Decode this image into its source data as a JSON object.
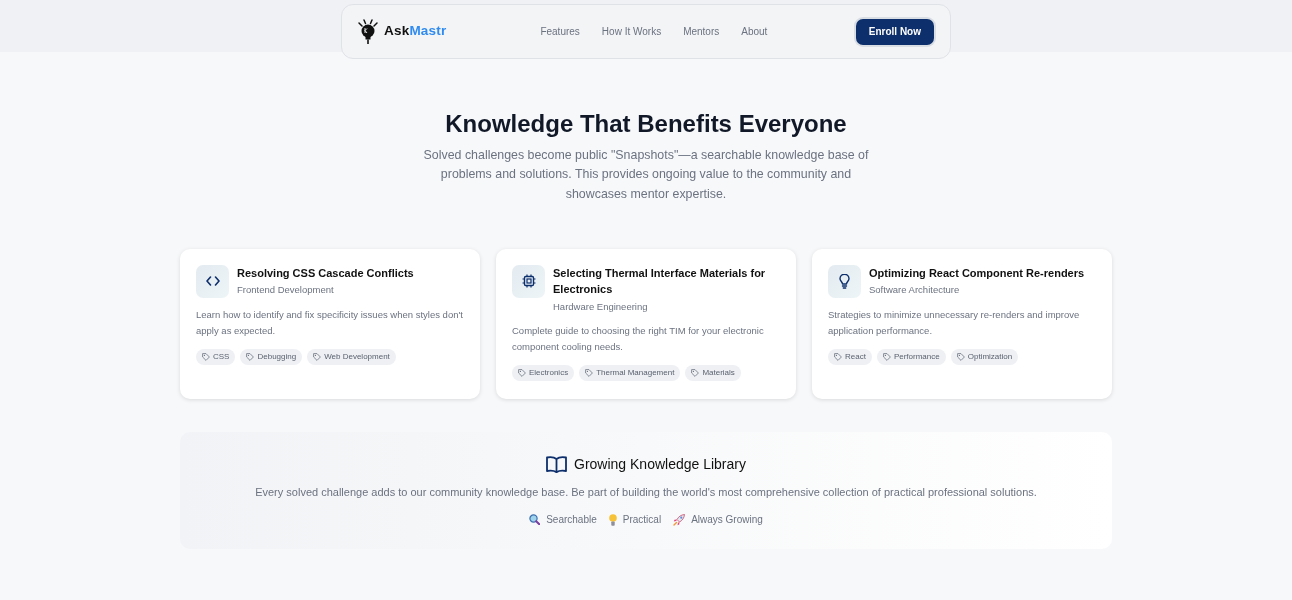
{
  "nav": {
    "brand": {
      "text": "Ask",
      "highlight": "Mastr"
    },
    "links": [
      "Features",
      "How It Works",
      "Mentors",
      "About"
    ],
    "cta": "Enroll Now"
  },
  "hero": {
    "title": "Knowledge That Benefits Everyone",
    "subtitle": "Solved challenges become public \"Snapshots\"—a searchable knowledge base of problems and solutions. This provides ongoing value to the community and showcases mentor expertise."
  },
  "snapshots": [
    {
      "kind": "code",
      "title": "Resolving CSS Cascade Conflicts",
      "category": "Frontend Development",
      "description": "Learn how to identify and fix specificity issues when styles don't apply as expected.",
      "tags": [
        "CSS",
        "Debugging",
        "Web Development"
      ]
    },
    {
      "kind": "chip",
      "title": "Selecting Thermal Interface Materials for Electronics",
      "category": "Hardware Engineering",
      "description": "Complete guide to choosing the right TIM for your electronic component cooling needs.",
      "tags": [
        "Electronics",
        "Thermal Management",
        "Materials"
      ]
    },
    {
      "kind": "bulb",
      "title": "Optimizing React Component Re-renders",
      "category": "Software Architecture",
      "description": "Strategies to minimize unnecessary re-renders and improve application performance.",
      "tags": [
        "React",
        "Performance",
        "Optimization"
      ]
    }
  ],
  "library": {
    "title": "Growing Knowledge Library",
    "text": "Every solved challenge adds to our community knowledge base. Be part of building the world's most comprehensive collection of practical professional solutions.",
    "features": [
      {
        "kind": "search",
        "label": "Searchable"
      },
      {
        "kind": "bulb",
        "label": "Practical"
      },
      {
        "kind": "rocket",
        "label": "Always Growing"
      }
    ]
  }
}
